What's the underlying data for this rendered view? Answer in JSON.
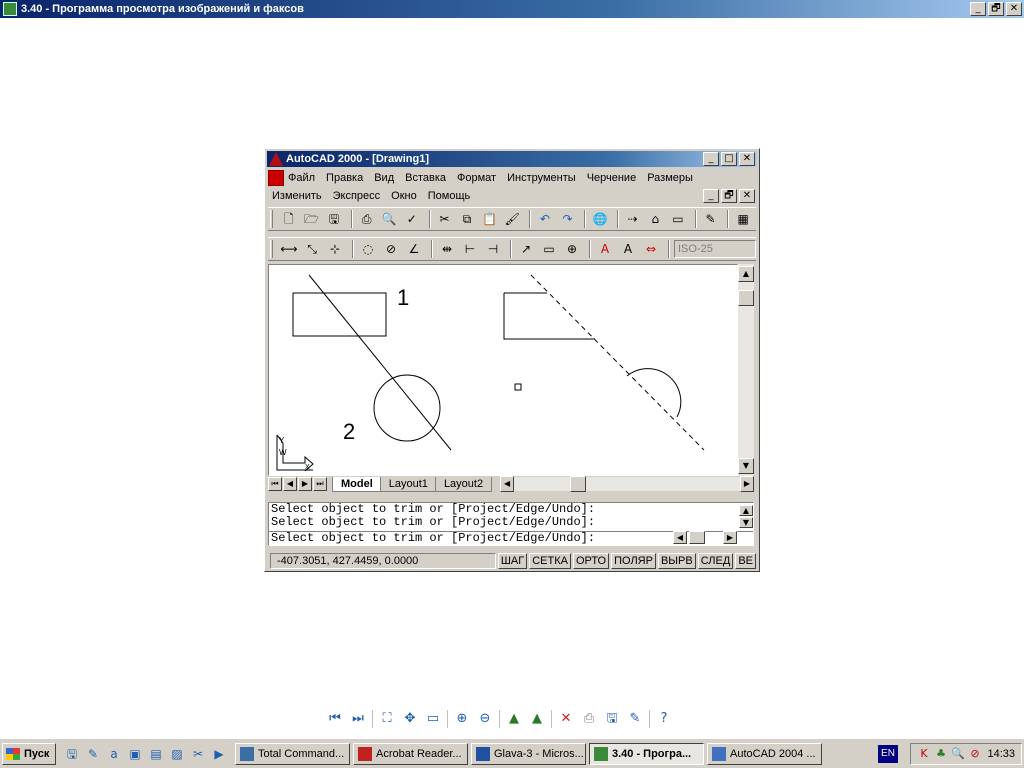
{
  "window": {
    "title": "3.40 - Программа просмотра изображений и факсов",
    "buttons": [
      "_",
      "🗗",
      "✕"
    ]
  },
  "acad": {
    "title": "AutoCAD 2000 - [Drawing1]",
    "menu_row1": [
      "Файл",
      "Правка",
      "Вид",
      "Вставка",
      "Формат",
      "Инструменты",
      "Черчение",
      "Размеры"
    ],
    "menu_row2": [
      "Изменить",
      "Экспресс",
      "Окно",
      "Помощь"
    ],
    "dimstyle": "ISO-25",
    "drawing_labels": {
      "label1": "1",
      "label2": "2"
    },
    "ucs": {
      "y": "Y",
      "w": "W",
      "x": "X"
    },
    "tabs": [
      "Model",
      "Layout1",
      "Layout2"
    ],
    "command_lines": [
      "Select object to trim or [Project/Edge/Undo]:",
      "Select object to trim or [Project/Edge/Undo]:",
      "Select object to trim or [Project/Edge/Undo]:"
    ],
    "status": {
      "coords": "-407.3051, 427.4459, 0.0000",
      "buttons": [
        "ШАГ",
        "СЕТКА",
        "ОРТО",
        "ПОЛЯР",
        "ВЫРВ",
        "СЛЕД",
        "ВЕ"
      ]
    }
  },
  "taskbar": {
    "start": "Пуск",
    "tasks": [
      {
        "label": "Total Command...",
        "active": false
      },
      {
        "label": "Acrobat Reader...",
        "active": false
      },
      {
        "label": "Glava-3 - Micros...",
        "active": false
      },
      {
        "label": "3.40 - Програ...",
        "active": true
      },
      {
        "label": "AutoCAD 2004 ...",
        "active": false
      }
    ],
    "lang": "EN",
    "clock": "14:33"
  }
}
